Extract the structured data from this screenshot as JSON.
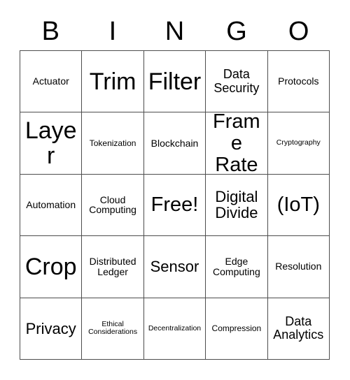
{
  "card": {
    "title_letters": [
      "B",
      "I",
      "N",
      "G",
      "O"
    ],
    "free_space_label": "Free!",
    "border_color": "#4d4d4d",
    "text_color": "#000000",
    "background_color": "#ffffff",
    "grid_size": "5x5",
    "rows": [
      [
        {
          "label": "Actuator",
          "size": "s"
        },
        {
          "label": "Trim",
          "size": "xxl"
        },
        {
          "label": "Filter",
          "size": "xxl"
        },
        {
          "label": "Data Security",
          "size": "m"
        },
        {
          "label": "Protocols",
          "size": "s"
        }
      ],
      [
        {
          "label": "Layer",
          "size": "xxl"
        },
        {
          "label": "Tokenization",
          "size": "xs"
        },
        {
          "label": "Blockchain",
          "size": "s"
        },
        {
          "label": "Frame Rate",
          "size": "xl"
        },
        {
          "label": "Cryptography",
          "size": "xxs"
        }
      ],
      [
        {
          "label": "Automation",
          "size": "s"
        },
        {
          "label": "Cloud Computing",
          "size": "s"
        },
        {
          "label": "Free!",
          "size": "xl"
        },
        {
          "label": "Digital Divide",
          "size": "l"
        },
        {
          "label": "(IoT)",
          "size": "xl"
        }
      ],
      [
        {
          "label": "Crop",
          "size": "xxl"
        },
        {
          "label": "Distributed Ledger",
          "size": "s"
        },
        {
          "label": "Sensor",
          "size": "l"
        },
        {
          "label": "Edge Computing",
          "size": "s"
        },
        {
          "label": "Resolution",
          "size": "s"
        }
      ],
      [
        {
          "label": "Privacy",
          "size": "l"
        },
        {
          "label": "Ethical Considerations",
          "size": "xxs"
        },
        {
          "label": "Decentralization",
          "size": "xxs"
        },
        {
          "label": "Compression",
          "size": "xs"
        },
        {
          "label": "Data Analytics",
          "size": "m"
        }
      ]
    ]
  }
}
